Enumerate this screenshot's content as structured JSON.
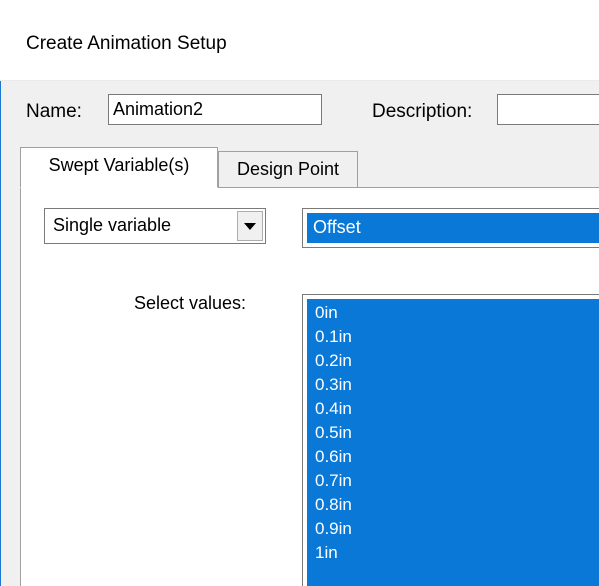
{
  "window": {
    "title": "Create Animation Setup"
  },
  "form": {
    "name_label": "Name:",
    "name_value": "Animation2",
    "description_label": "Description:",
    "description_value": ""
  },
  "tabs": [
    {
      "label": "Swept Variable(s)",
      "active": true
    },
    {
      "label": "Design Point",
      "active": false
    }
  ],
  "sweep": {
    "mode_value": "Single variable",
    "variable_value": "Offset",
    "select_values_label": "Select values:",
    "values": [
      "0in",
      "0.1in",
      "0.2in",
      "0.3in",
      "0.4in",
      "0.5in",
      "0.6in",
      "0.7in",
      "0.8in",
      "0.9in",
      "1in"
    ]
  },
  "colors": {
    "selection": "#0a78d7",
    "accent_edge": "#1b77d2"
  },
  "icons": {
    "combo_arrow": "chevron-down-icon"
  }
}
